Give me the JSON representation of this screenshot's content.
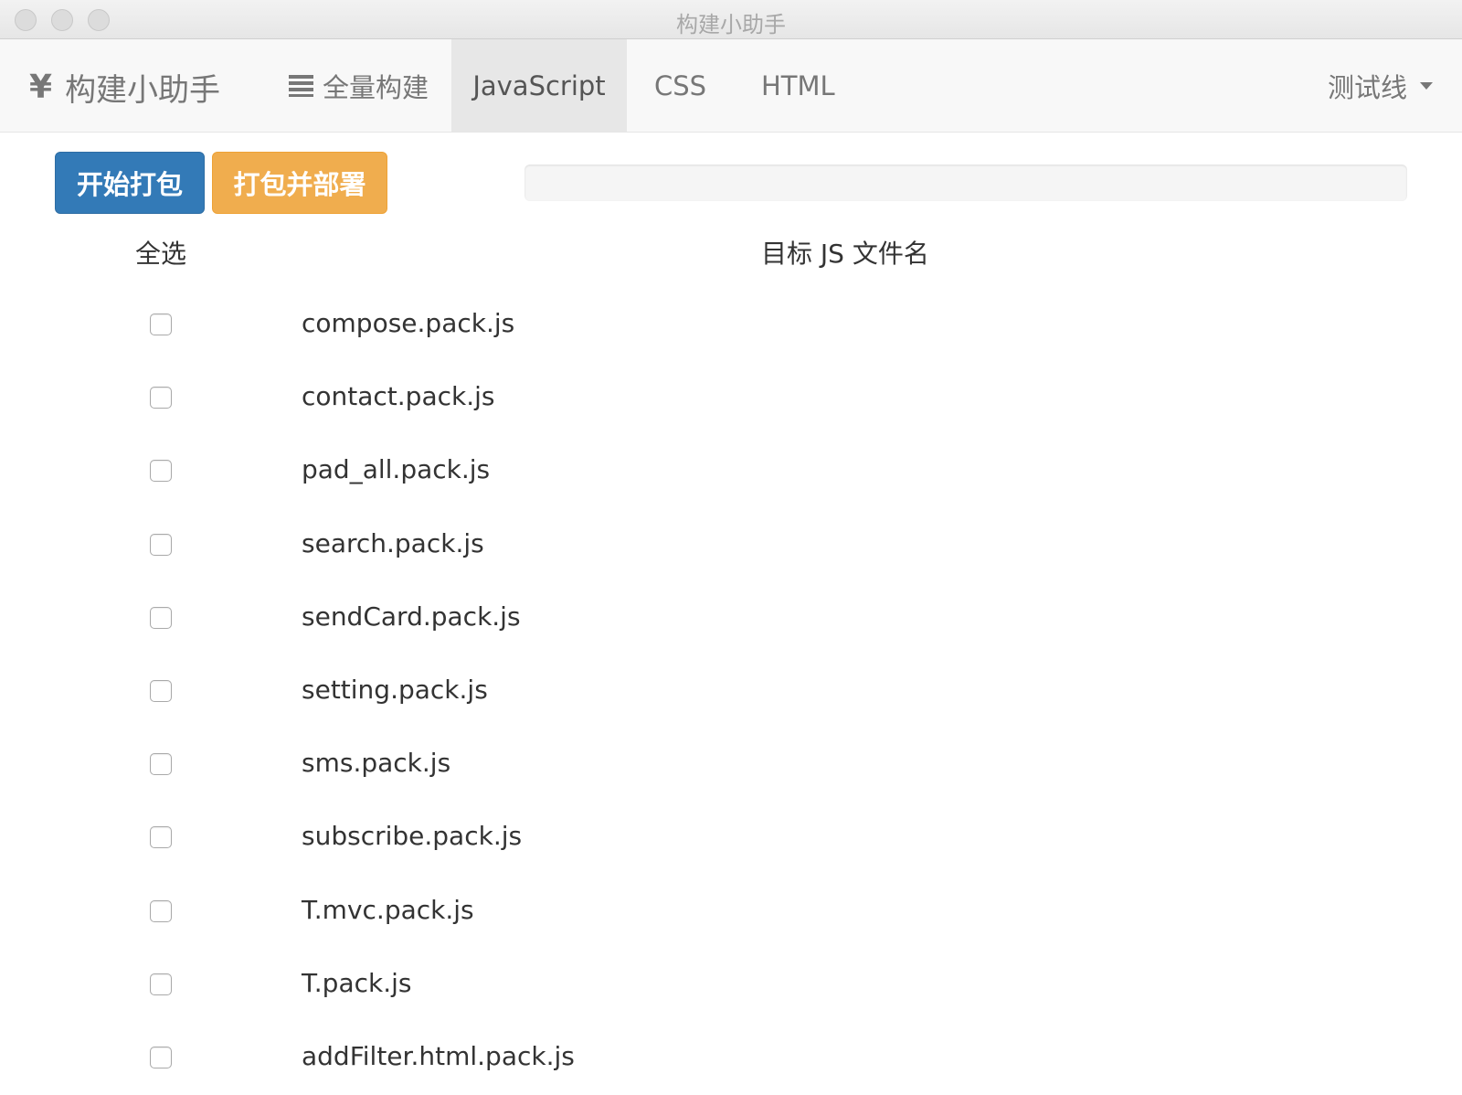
{
  "window": {
    "title": "构建小助手"
  },
  "navbar": {
    "brand_icon": "¥",
    "brand_label": "构建小助手",
    "items": [
      {
        "label": "全量构建",
        "icon": "list-icon",
        "active": false
      },
      {
        "label": "JavaScript",
        "active": true
      },
      {
        "label": "CSS",
        "active": false
      },
      {
        "label": "HTML",
        "active": false
      }
    ],
    "env_dropdown": {
      "selected": "测试线"
    }
  },
  "actions": {
    "start_pack_label": "开始打包",
    "pack_deploy_label": "打包并部署",
    "progress": 0
  },
  "table": {
    "headers": {
      "select_all": "全选",
      "file_name": "目标 JS 文件名"
    },
    "rows": [
      {
        "file": "compose.pack.js",
        "checked": false
      },
      {
        "file": "contact.pack.js",
        "checked": false
      },
      {
        "file": "pad_all.pack.js",
        "checked": false
      },
      {
        "file": "search.pack.js",
        "checked": false
      },
      {
        "file": "sendCard.pack.js",
        "checked": false
      },
      {
        "file": "setting.pack.js",
        "checked": false
      },
      {
        "file": "sms.pack.js",
        "checked": false
      },
      {
        "file": "subscribe.pack.js",
        "checked": false
      },
      {
        "file": "T.mvc.pack.js",
        "checked": false
      },
      {
        "file": "T.pack.js",
        "checked": false
      },
      {
        "file": "addFilter.html.pack.js",
        "checked": false
      }
    ]
  },
  "colors": {
    "primary": "#337ab7",
    "warning": "#f0ad4e",
    "navbar_bg": "#f8f8f8",
    "nav_active_bg": "#e7e7e7"
  }
}
